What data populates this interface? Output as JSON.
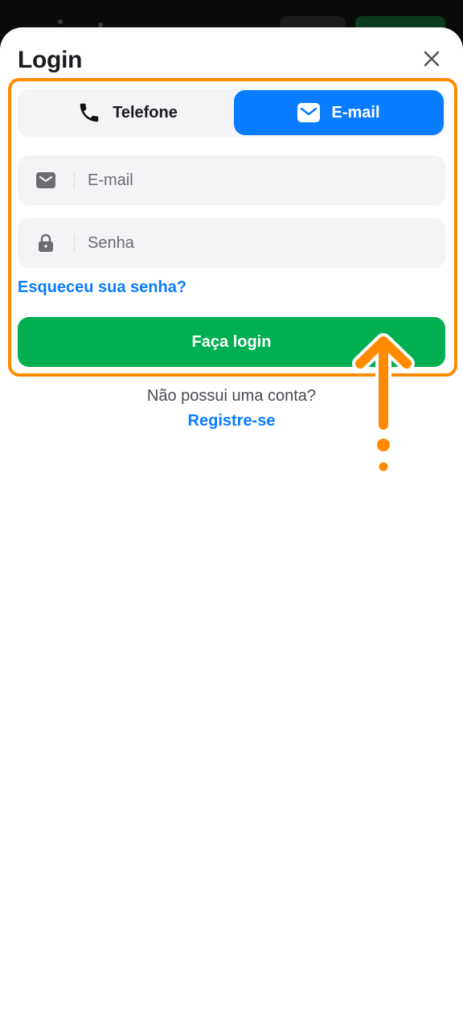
{
  "modal": {
    "title": "Login",
    "tabs": [
      {
        "label": "Telefone",
        "icon": "phone-icon",
        "active": false
      },
      {
        "label": "E-mail",
        "icon": "envelope-icon",
        "active": true
      }
    ],
    "email_field": {
      "placeholder": "E-mail",
      "value": "",
      "icon": "envelope-icon"
    },
    "password_field": {
      "placeholder": "Senha",
      "value": "",
      "icon": "lock-icon"
    },
    "forgot_link": "Esqueceu sua senha?",
    "login_button": "Faça login",
    "no_account_text": "Não possui uma conta?",
    "register_link": "Registre-se"
  },
  "colors": {
    "accent_blue": "#0a7cff",
    "login_green": "#00b050",
    "highlight_orange": "#ff8a00",
    "field_bg": "#f4f4f6"
  },
  "annotation": {
    "type": "highlight-and-arrow",
    "color": "#ff8a00"
  }
}
